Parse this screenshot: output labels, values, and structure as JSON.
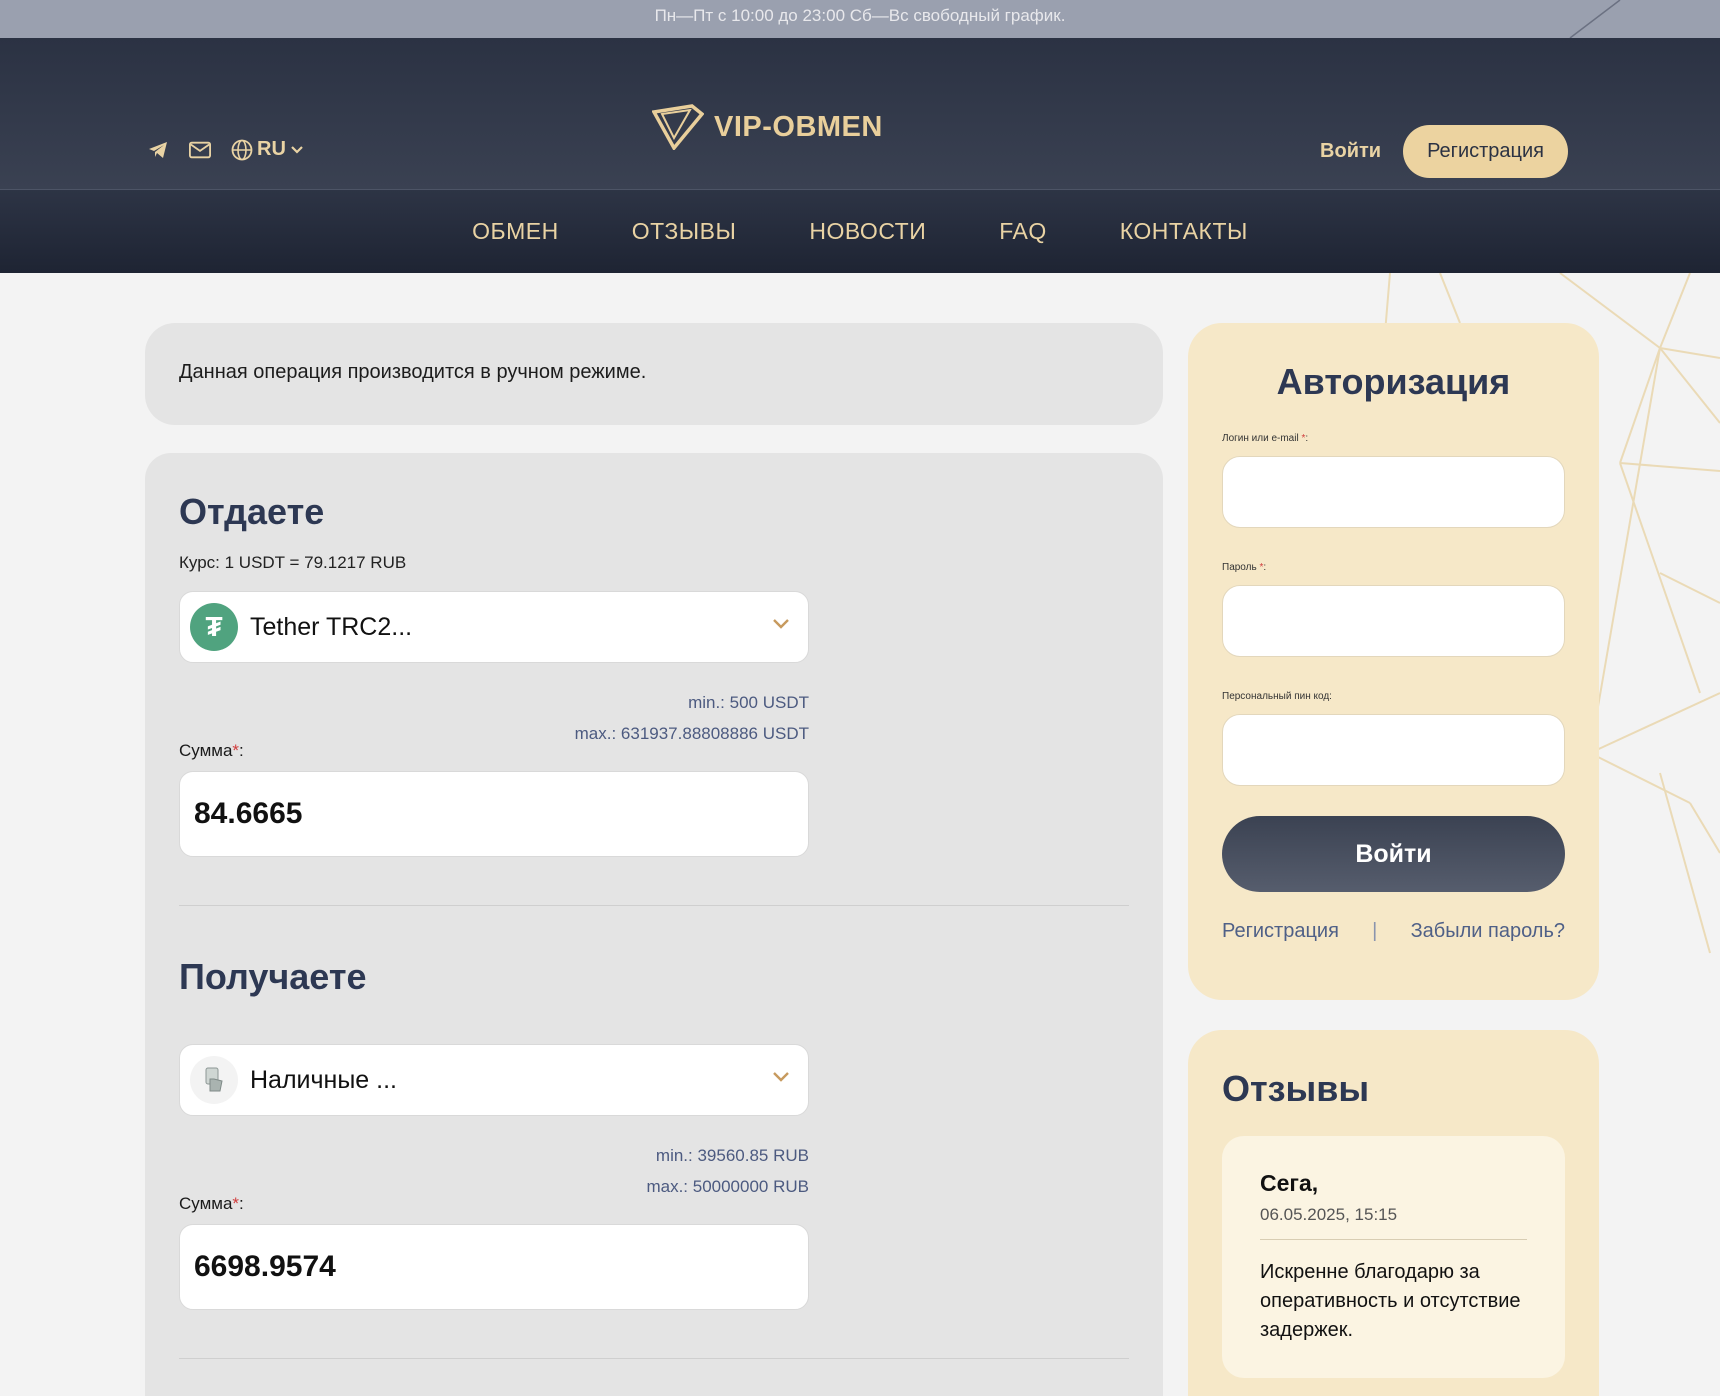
{
  "topbar": {
    "hours": "Пн—Пт с 10:00 до 23:00 Сб—Вс свободный график."
  },
  "header": {
    "lang": "RU",
    "logo_text": "VIP-OBMEN",
    "login_label": "Войти",
    "register_label": "Регистрация"
  },
  "nav": [
    "ОБМЕН",
    "ОТЗЫВЫ",
    "НОВОСТИ",
    "FAQ",
    "КОНТАКТЫ"
  ],
  "notice": "Данная операция производится в ручном режиме.",
  "give": {
    "title": "Отдаете",
    "rate": "Курс: 1 USDT = 79.1217 RUB",
    "currency": "Tether TRC2...",
    "min": "min.: 500 USDT",
    "max": "max.: 631937.88808886 USDT",
    "amount_label": "Сумма",
    "amount_suffix": ":",
    "amount": "84.6665"
  },
  "receive": {
    "title": "Получаете",
    "currency": "Наличные ...",
    "min": "min.: 39560.85 RUB",
    "max": "max.: 50000000 RUB",
    "amount_label": "Сумма",
    "amount_suffix": ":",
    "amount": "6698.9574"
  },
  "auth": {
    "title": "Авторизация",
    "login_label": "Логин или e-mail",
    "password_label": "Пароль",
    "pin_label": "Персональный пин код:",
    "submit": "Войти",
    "register_link": "Регистрация",
    "separator": "|",
    "forgot_link": "Забыли пароль?"
  },
  "reviews": {
    "title": "Отзывы",
    "items": [
      {
        "name": "Сега,",
        "date": "06.05.2025, 15:15",
        "text": "Искренне благодарю за оперативность и отсутствие задержек."
      }
    ]
  },
  "colors": {
    "accent": "#e9d3a4",
    "dark": "#2b3243",
    "panel": "#f6e8c8",
    "usdt": "#50a37f"
  }
}
